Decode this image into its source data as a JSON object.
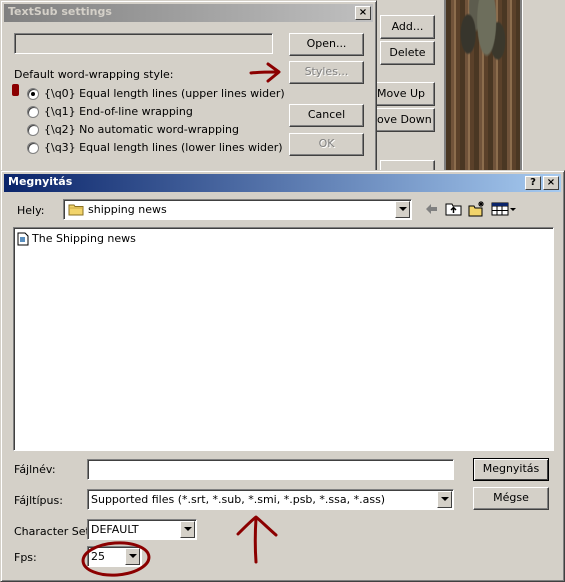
{
  "background_window": {
    "buttons": {
      "add": "Add...",
      "delete": "Delete",
      "move_up": "Move Up",
      "move_down": "ove Down"
    }
  },
  "textsub": {
    "title": "TextSub settings",
    "close_glyph": "×",
    "file_path_value": "",
    "open_button": "Open...",
    "styles_button": "Styles...",
    "wrap_label": "Default word-wrapping style:",
    "options": [
      {
        "label": "{\\q0} Equal length lines (upper lines wider)",
        "selected": true
      },
      {
        "label": "{\\q1} End-of-line wrapping",
        "selected": false
      },
      {
        "label": "{\\q2} No automatic word-wrapping",
        "selected": false
      },
      {
        "label": "{\\q3} Equal length lines (lower lines wider)",
        "selected": false
      }
    ],
    "cancel_button": "Cancel",
    "ok_button": "OK"
  },
  "open_dialog": {
    "title": "Megnyitás",
    "help_glyph": "?",
    "close_glyph": "×",
    "location_label": "Hely:",
    "location_value": "shipping news",
    "files": [
      {
        "name": "The Shipping news"
      }
    ],
    "filename_label": "Fájlnév:",
    "filename_value": "",
    "filetype_label": "Fájltípus:",
    "filetype_value": "Supported files (*.srt, *.sub, *.smi, *.psb, *.ssa, *.ass)",
    "charset_label": "Character Set:",
    "charset_value": "DEFAULT",
    "fps_label": "Fps:",
    "fps_value": "25",
    "open_button": "Megnyitás",
    "cancel_button": "Mégse"
  },
  "colors": {
    "face": "#d4d0c8",
    "title_active_start": "#0a246a",
    "title_active_end": "#a6caf0",
    "title_inactive_start": "#808080",
    "title_inactive_end": "#c0c0c0",
    "annotation": "#8b0000"
  },
  "icons": {
    "folder": "folder-icon",
    "file": "file-icon",
    "back": "back-arrow-icon",
    "up": "up-folder-icon",
    "new_folder": "new-folder-icon",
    "view": "view-menu-icon"
  }
}
